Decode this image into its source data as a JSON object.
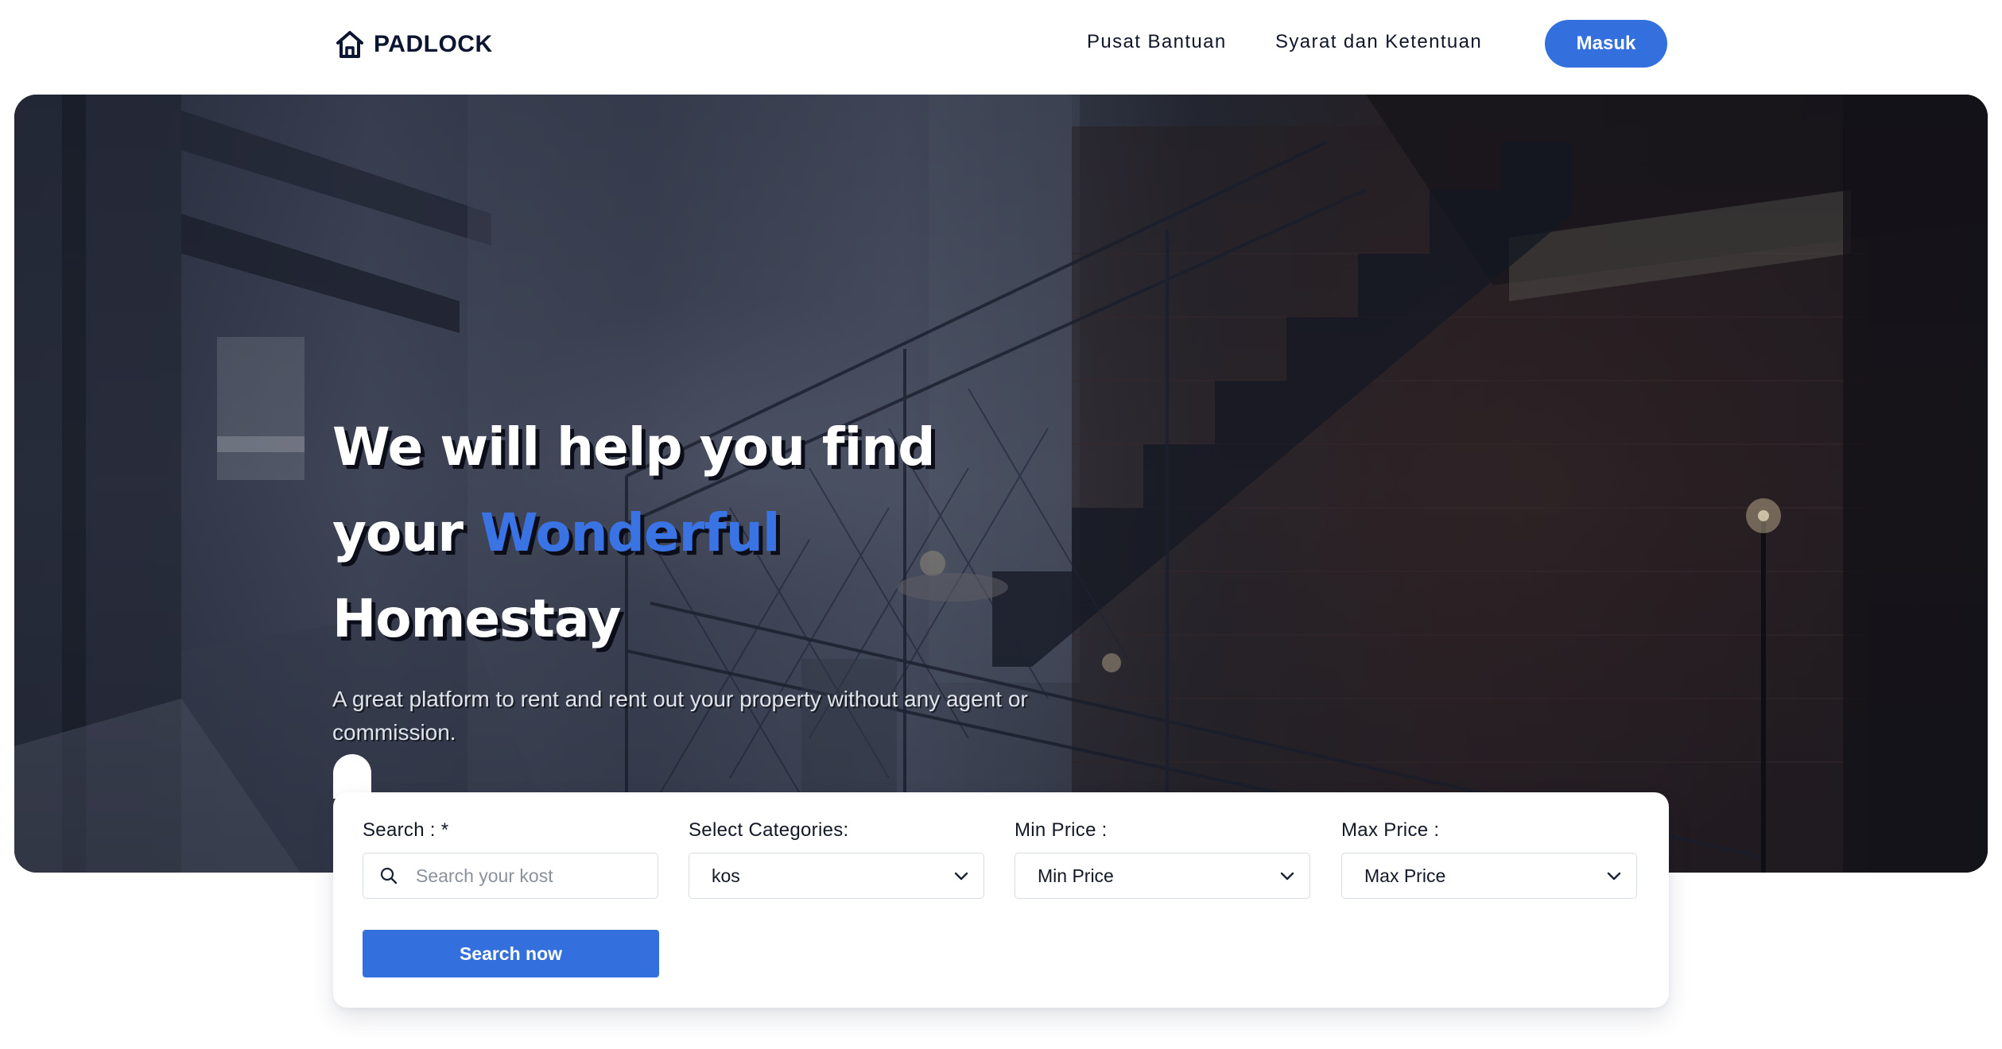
{
  "brand": {
    "name": "PADLOCK"
  },
  "nav": {
    "help_label": "Pusat Bantuan",
    "terms_label": "Syarat dan Ketentuan",
    "login_label": "Masuk"
  },
  "hero": {
    "title_line1": "We will help you find",
    "title_line2_prefix": "your",
    "title_line2_accent": "Wonderful",
    "title_line3": "Homestay",
    "subtitle": "A great platform to rent and rent out your property without any agent or commission."
  },
  "search": {
    "search_label": "Search : *",
    "search_placeholder": "Search your kost",
    "search_value": "",
    "category_label": "Select Categories:",
    "category_value": "kos",
    "min_price_label": "Min Price :",
    "min_price_value": "Min Price",
    "max_price_label": "Max Price :",
    "max_price_value": "Max Price",
    "submit_label": "Search now"
  },
  "colors": {
    "primary": "#3470dd",
    "accent_text": "#3a73e3",
    "brand_dark": "#0b1530"
  },
  "icons": {
    "brand": "house-icon",
    "search": "search-icon",
    "dropdown": "chevron-down-icon"
  }
}
